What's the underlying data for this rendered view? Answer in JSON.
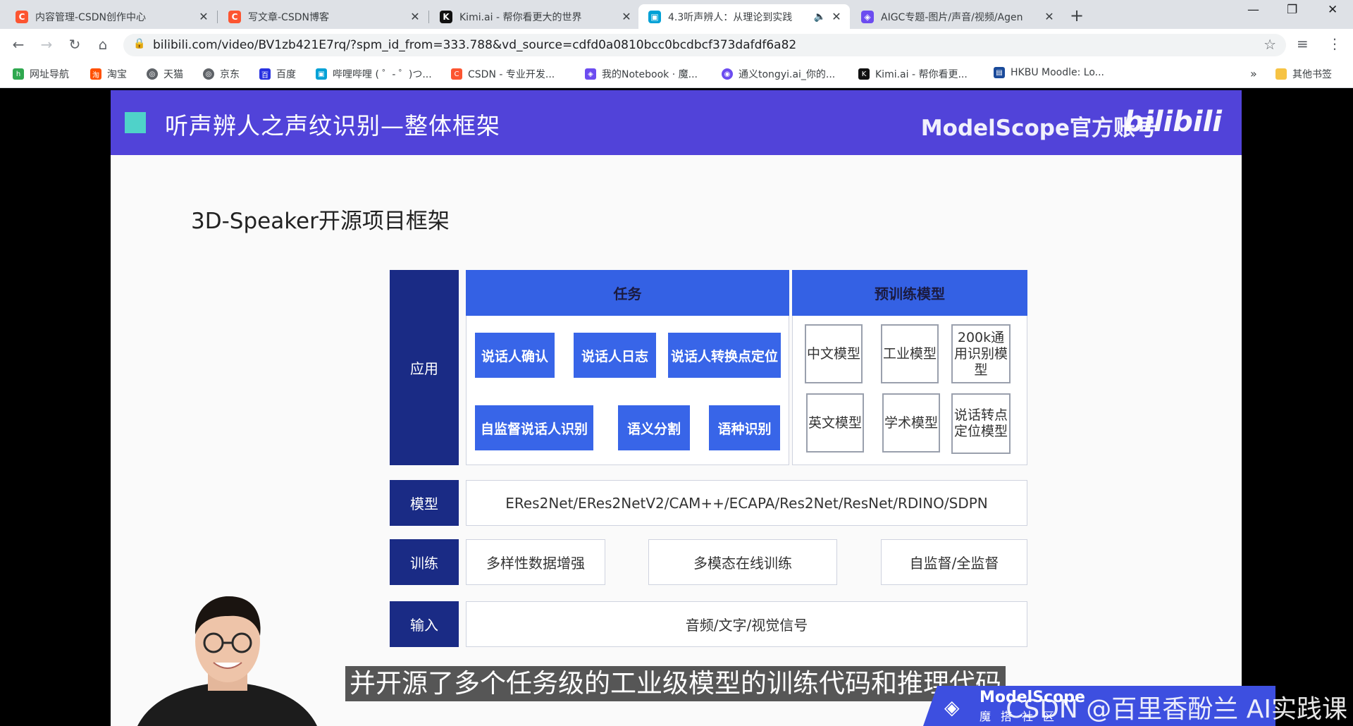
{
  "browser": {
    "tabs": [
      {
        "title": "内容管理-CSDN创作中心",
        "icon": "csdn-icon",
        "color": "#fc5531"
      },
      {
        "title": "写文章-CSDN博客",
        "icon": "csdn-icon",
        "color": "#fc5531"
      },
      {
        "title": "Kimi.ai - 帮你看更大的世界",
        "icon": "kimi-icon",
        "color": "#111111"
      },
      {
        "title": "4.3听声辨人：从理论到实践",
        "icon": "bilibili-icon",
        "color": "#00a1d6"
      },
      {
        "title": "AIGC专题-图片/声音/视频/Agen",
        "icon": "aigc-icon",
        "color": "#6c4cf0"
      }
    ],
    "url": "bilibili.com/video/BV1zb421E7rq/?spm_id_from=333.788&vd_source=cdfd0a0810bcc0bcdbcf373dafdf6a82",
    "bookmarks": [
      {
        "label": "网址导航",
        "icon": "hao-icon",
        "color": "#2fa84f"
      },
      {
        "label": "淘宝",
        "icon": "taobao-icon",
        "color": "#ff5000"
      },
      {
        "label": "天猫",
        "icon": "globe-icon",
        "color": "#5f6368"
      },
      {
        "label": "京东",
        "icon": "globe-icon",
        "color": "#5f6368"
      },
      {
        "label": "百度",
        "icon": "baidu-icon",
        "color": "#2932e1"
      },
      {
        "label": "哔哩哔哩 ( ゜- ゜)つ...",
        "icon": "bilibili-icon",
        "color": "#00a1d6"
      },
      {
        "label": "CSDN - 专业开发...",
        "icon": "csdn-icon",
        "color": "#fc5531"
      },
      {
        "label": "我的Notebook · 魔...",
        "icon": "modelscope-icon",
        "color": "#6c4cf0"
      },
      {
        "label": "通义tongyi.ai_你的...",
        "icon": "tongyi-icon",
        "color": "#6c4cf0"
      },
      {
        "label": "Kimi.ai - 帮你看更...",
        "icon": "kimi-icon",
        "color": "#111111"
      },
      {
        "label": "HKBU Moodle: Lo...",
        "icon": "moodle-icon",
        "color": "#1a4a9a"
      }
    ],
    "bookmarks_more": "»",
    "other_bookmarks": "其他书签"
  },
  "slide": {
    "header_title": "听声辨人之声纹识别—整体框架",
    "brand": "ModelScope官方账号",
    "brand_logo": "bilibili",
    "subtitle": "3D-Speaker开源项目框架",
    "framework": {
      "app_label": "应用",
      "task_header": "任务",
      "tasks": [
        "说话人确认",
        "说话人日志",
        "说话人转换点定位",
        "自监督说话人识别",
        "语义分割",
        "语种识别"
      ],
      "pretrained_header": "预训练模型",
      "pretrained_models": [
        "中文模型",
        "工业模型",
        "200k通用识别模型",
        "英文模型",
        "学术模型",
        "说话转点定位模型"
      ],
      "model_label": "模型",
      "model_list": "ERes2Net/ERes2NetV2/CAM++/ECAPA/Res2Net/ResNet/RDINO/SDPN",
      "train_label": "训练",
      "train_items": [
        "多样性数据增强",
        "多模态在线训练",
        "自监督/全监督"
      ],
      "input_label": "输入",
      "input_value": "音频/文字/视觉信号"
    }
  },
  "caption": "并开源了多个任务级的工业级模型的训练代码和推理代码",
  "modelscope_logo": {
    "line1": "ModelScope",
    "line2": "魔搭社区"
  },
  "watermark": "CSDN @百里香酚兰 AI实践课"
}
